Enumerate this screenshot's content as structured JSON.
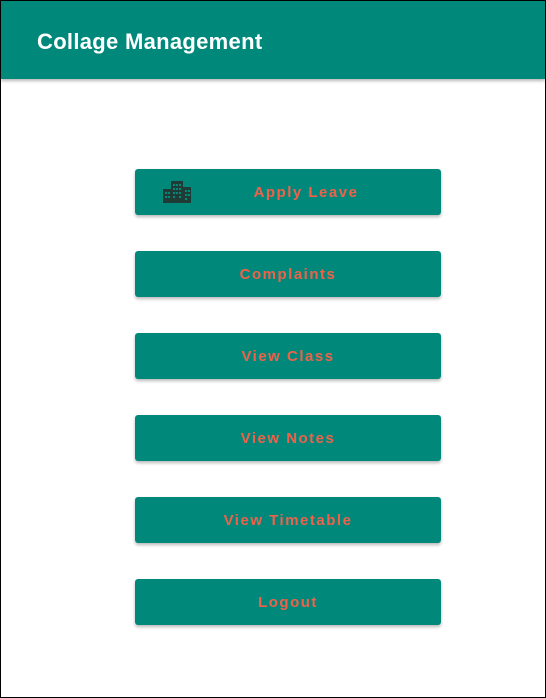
{
  "app": {
    "title": "Collage Management"
  },
  "menu": {
    "apply_leave": {
      "label": "Apply Leave",
      "icon": "building-icon"
    },
    "complaints": {
      "label": "Complaints"
    },
    "view_class": {
      "label": "View Class"
    },
    "view_notes": {
      "label": "View Notes"
    },
    "view_timetable": {
      "label": "View Timetable"
    },
    "logout": {
      "label": "Logout"
    }
  },
  "colors": {
    "primary": "#00897b",
    "button_text": "#f0614a",
    "icon": "#1f3b36"
  }
}
